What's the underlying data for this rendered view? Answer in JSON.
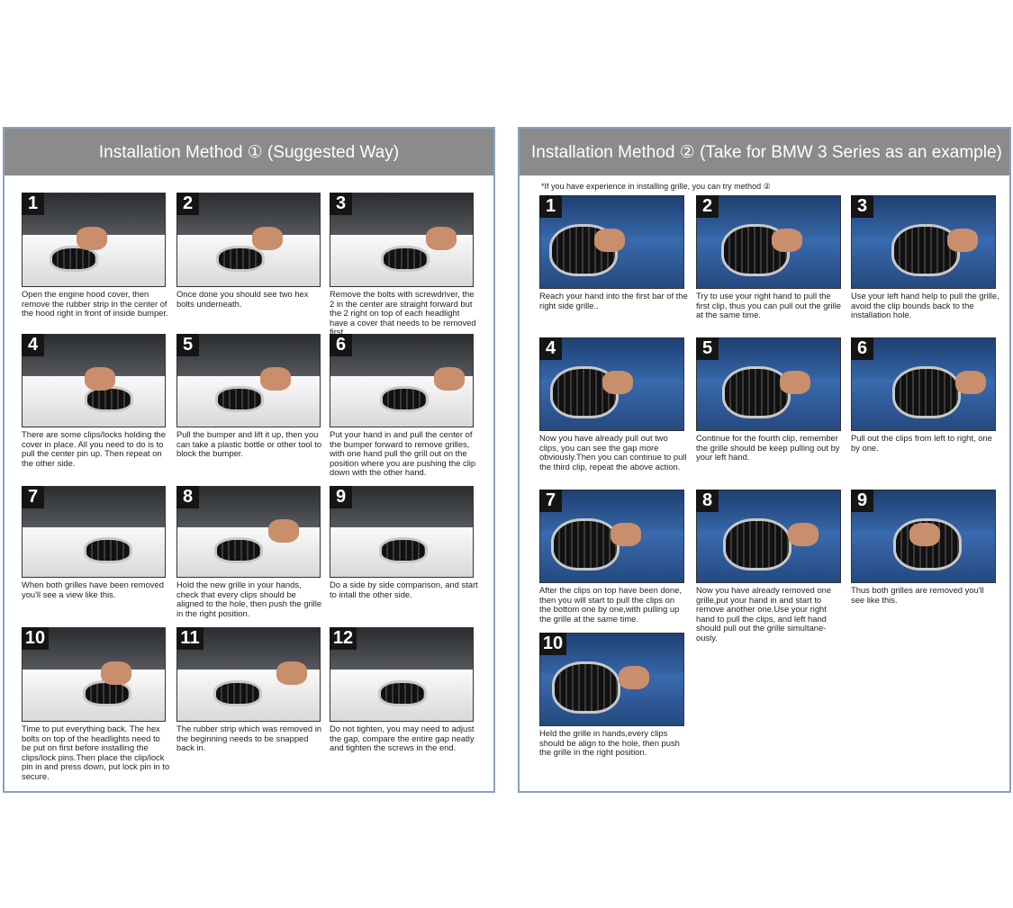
{
  "method1": {
    "title": "Installation Method ①  (Suggested Way)",
    "steps": [
      {
        "num": "1",
        "caption": "Open the engine hood cover, then remove the rubber strip in the center of the hood right in front of inside bumper."
      },
      {
        "num": "2",
        "caption": "Once done you should see two hex bolts underneath."
      },
      {
        "num": "3",
        "caption": "Remove the bolts with screwdriver, the 2 in the center are straight forward but the 2 right on top of each headlight have a cover that needs to be removed first."
      },
      {
        "num": "4",
        "caption": "There are some clips/locks holding the cover in place. All you need to do is to pull the center pin up. Then repeat on the other side."
      },
      {
        "num": "5",
        "caption": "Pull the bumper and lift it up, then you can take a plastic bottle or other tool to block the bumper."
      },
      {
        "num": "6",
        "caption": "Put your hand in and pull the center of the bumper forward to remove grilles, with one hand pull the grill out on the position where you are pushing the clip down with the other hand."
      },
      {
        "num": "7",
        "caption": "When both grilles have been removed you'll see a view like this."
      },
      {
        "num": "8",
        "caption": "Hold the new grille in your hands, check that every clips should be aligned to the hole, then push the grille in the right position."
      },
      {
        "num": "9",
        "caption": "Do a side by side comparison, and start to intall the other side."
      },
      {
        "num": "10",
        "caption": "Time to put everything back. The hex bolts on top of the headlights need to be put on first before installing the clips/lock pins.Then place the clip/lock pin in and press down, put lock pin in to secure."
      },
      {
        "num": "11",
        "caption": "The rubber strip which was removed in the beginning needs to be snapped back in."
      },
      {
        "num": "12",
        "caption": "Do not tighten, you may need to adjust the gap, compare the entire gap neatly and tighten the screws in the end."
      }
    ]
  },
  "method2": {
    "title": "Installation Method ②  (Take for BMW 3 Series as an example)",
    "note": "*If you have experience in installing grille, you can try method ②",
    "steps": [
      {
        "num": "1",
        "caption": "Reach your hand into the first bar of the right side grille.."
      },
      {
        "num": "2",
        "caption": "Try to use your right hand to pull the first clip, thus you can pull out the grille at the same time."
      },
      {
        "num": "3",
        "caption": "Use your left hand help to pull the grille, avoid the clip bounds back to the installation hole."
      },
      {
        "num": "4",
        "caption": "Now you have already pull out two clips, you can see the gap more obviously.Then you can continue to pull the third clip, repeat the above action."
      },
      {
        "num": "5",
        "caption": "Continue for the fourth clip, remember the grille should be keep pulling out by your left hand."
      },
      {
        "num": "6",
        "caption": "Pull out the clips from left to right, one by one."
      },
      {
        "num": "7",
        "caption": "After the clips on top have been done, then you will start to pull the clips on the bottom one by one,with pulling up the grille at the same time."
      },
      {
        "num": "8",
        "caption": "Now you have already removed one grille,put your hand in and start to remove another one.Use your right hand to pull the clips, and left hand should pull out the grille simultane-ously."
      },
      {
        "num": "9",
        "caption": "Thus both grilles are removed you'll see like this."
      },
      {
        "num": "10",
        "caption": "Held the grille in hands,every clips should be align to the hole, then push the grille in the right position."
      }
    ]
  },
  "colors": {
    "header_bg": "#8b8b8b",
    "panel_border": "#8aa1bd",
    "number_badge": "#151515",
    "car_white": "#f1f1f1",
    "car_blue": "#2f5b9a"
  }
}
